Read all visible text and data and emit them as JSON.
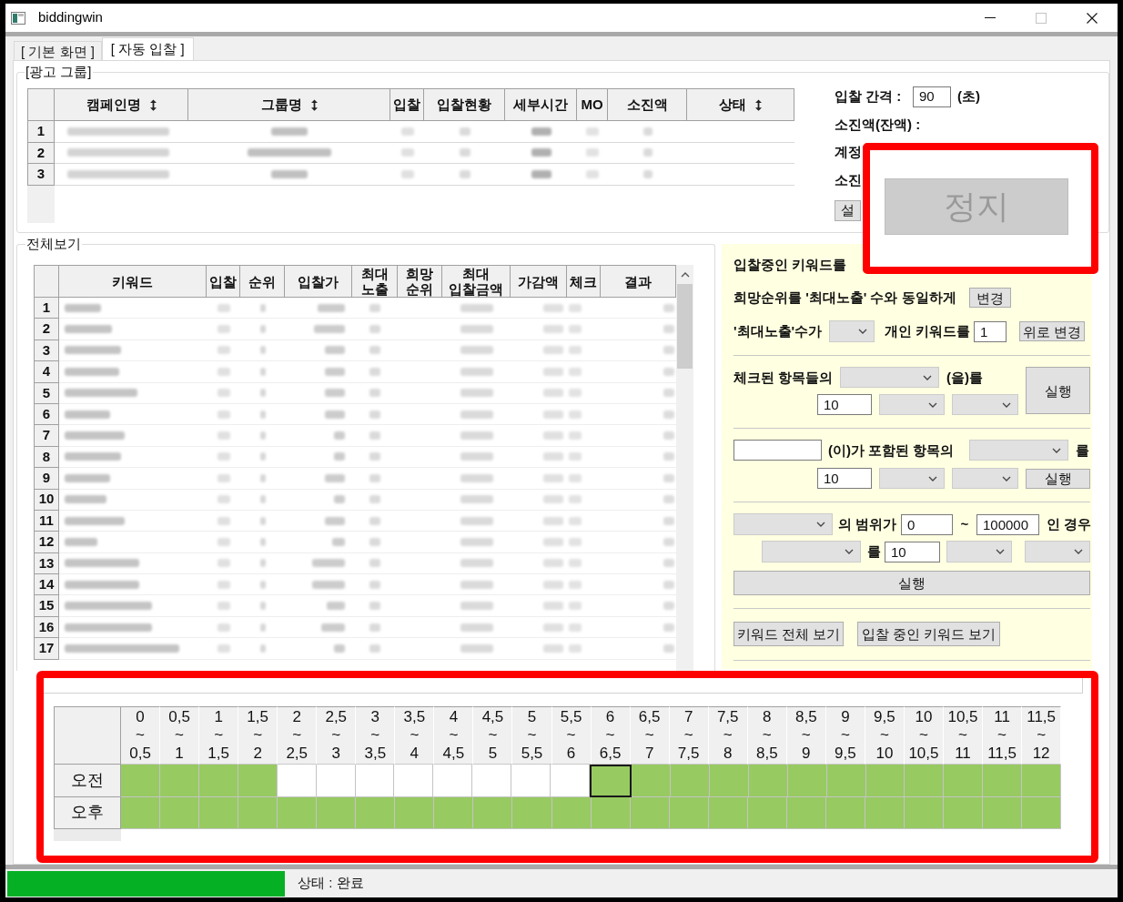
{
  "window": {
    "title": "biddingwin"
  },
  "tabs": [
    {
      "label": "[ 기본 화면 ]",
      "selected": false
    },
    {
      "label": "[ 자동 입찰 ]",
      "selected": true
    }
  ],
  "ad_group": {
    "title": "[광고 그룹]",
    "columns": [
      {
        "label": "캠페인명",
        "sortable": true
      },
      {
        "label": "그룹명",
        "sortable": true
      },
      {
        "label": "입찰",
        "sortable": false
      },
      {
        "label": "입찰현황",
        "sortable": false
      },
      {
        "label": "세부시간",
        "sortable": false
      },
      {
        "label": "MO",
        "sortable": false
      },
      {
        "label": "소진액",
        "sortable": false
      },
      {
        "label": "상태",
        "sortable": true
      }
    ],
    "rows": [
      {
        "number": "1"
      },
      {
        "number": "2"
      },
      {
        "number": "3"
      }
    ]
  },
  "bid_settings": {
    "interval_label": "입찰 간격 :",
    "interval_value": "90",
    "interval_unit": "(초)",
    "spend_label": "소진액(잔액) :",
    "account_label": "계정",
    "spend_label_2": "소진",
    "settings_button": "설"
  },
  "callout": {
    "stop_button": {
      "label": "정지",
      "disabled": true
    }
  },
  "overview": {
    "title": "전체보기",
    "columns": [
      {
        "label": "키워드"
      },
      {
        "label": "입찰"
      },
      {
        "label": "순위"
      },
      {
        "label": "입찰가"
      },
      {
        "label": "최대\n노출"
      },
      {
        "label": "희망\n순위"
      },
      {
        "label": "최대\n입찰금액"
      },
      {
        "label": "가감액"
      },
      {
        "label": "체크"
      },
      {
        "label": "결과"
      }
    ],
    "rows": [
      {
        "number": "1"
      },
      {
        "number": "2"
      },
      {
        "number": "3"
      },
      {
        "number": "4"
      },
      {
        "number": "5"
      },
      {
        "number": "6"
      },
      {
        "number": "7"
      },
      {
        "number": "8"
      },
      {
        "number": "9"
      },
      {
        "number": "10"
      },
      {
        "number": "11"
      },
      {
        "number": "12"
      },
      {
        "number": "13"
      },
      {
        "number": "14"
      },
      {
        "number": "15"
      },
      {
        "number": "16"
      },
      {
        "number": "17"
      }
    ]
  },
  "bulk_panel": {
    "heading": "입찰중인 키워드를",
    "groups": [
      {
        "items": [
          {
            "kind": "label",
            "text": "희망순위를 '최대노출' 수와 동일하게"
          },
          {
            "kind": "button",
            "text": "변경"
          }
        ]
      },
      {
        "items": [
          {
            "kind": "label",
            "text": "'최대노출'수가"
          },
          {
            "kind": "select"
          },
          {
            "kind": "label",
            "text": "개인 키워드를"
          },
          {
            "kind": "input",
            "value": "1"
          },
          {
            "kind": "button",
            "text": "위로 변경"
          }
        ]
      },
      {
        "items": [
          {
            "kind": "label",
            "text": "체크된 항목들의"
          },
          {
            "kind": "select"
          },
          {
            "kind": "label",
            "text": "(을)를"
          },
          {
            "kind": "button",
            "text": "실행"
          },
          {
            "kind": "input",
            "value": "10"
          },
          {
            "kind": "select"
          },
          {
            "kind": "select"
          }
        ]
      },
      {
        "items": [
          {
            "kind": "input"
          },
          {
            "kind": "label",
            "text": "(이)가 포함된 항목의"
          },
          {
            "kind": "select"
          },
          {
            "kind": "label",
            "text": "를"
          },
          {
            "kind": "input",
            "value": "10"
          },
          {
            "kind": "select"
          },
          {
            "kind": "select"
          },
          {
            "kind": "button",
            "text": "실행"
          }
        ]
      },
      {
        "items": [
          {
            "kind": "select"
          },
          {
            "kind": "label",
            "text": "의 범위가"
          },
          {
            "kind": "input",
            "value": "0"
          },
          {
            "kind": "label",
            "text": "~"
          },
          {
            "kind": "input",
            "value": "100000"
          },
          {
            "kind": "label",
            "text": "인 경우"
          },
          {
            "kind": "select"
          },
          {
            "kind": "label",
            "text": "를"
          },
          {
            "kind": "input",
            "value": "10"
          },
          {
            "kind": "select"
          },
          {
            "kind": "select"
          },
          {
            "kind": "button",
            "text": "실행"
          }
        ]
      },
      {
        "items": [
          {
            "kind": "button",
            "text": "키워드 전체 보기"
          },
          {
            "kind": "button",
            "text": "입찰 중인 키워드 보기"
          }
        ]
      }
    ]
  },
  "schedule": {
    "columns": [
      {
        "label": "0\n~\n0,5"
      },
      {
        "label": "0,5\n~\n1"
      },
      {
        "label": "1\n~\n1,5"
      },
      {
        "label": "1,5\n~\n2"
      },
      {
        "label": "2\n~\n2,5"
      },
      {
        "label": "2,5\n~\n3"
      },
      {
        "label": "3\n~\n3,5"
      },
      {
        "label": "3,5\n~\n4"
      },
      {
        "label": "4\n~\n4,5"
      },
      {
        "label": "4,5\n~\n5"
      },
      {
        "label": "5\n~\n5,5"
      },
      {
        "label": "5,5\n~\n6"
      },
      {
        "label": "6\n~\n6,5"
      },
      {
        "label": "6,5\n~\n7"
      },
      {
        "label": "7\n~\n7,5"
      },
      {
        "label": "7,5\n~\n8"
      },
      {
        "label": "8\n~\n8,5"
      },
      {
        "label": "8,5\n~\n9"
      },
      {
        "label": "9\n~\n9,5"
      },
      {
        "label": "9,5\n~\n10"
      },
      {
        "label": "10\n~\n10,5"
      },
      {
        "label": "10,5\n~\n11"
      },
      {
        "label": "11\n~\n11,5"
      },
      {
        "label": "11,5\n~\n12"
      }
    ],
    "rows": [
      {
        "label": "오전",
        "cells": [
          {
            "on": true,
            "selected": false
          },
          {
            "on": true,
            "selected": false
          },
          {
            "on": true,
            "selected": false
          },
          {
            "on": true,
            "selected": false
          },
          {
            "on": false,
            "selected": false
          },
          {
            "on": false,
            "selected": false
          },
          {
            "on": false,
            "selected": false
          },
          {
            "on": false,
            "selected": false
          },
          {
            "on": false,
            "selected": false
          },
          {
            "on": false,
            "selected": false
          },
          {
            "on": false,
            "selected": false
          },
          {
            "on": false,
            "selected": false
          },
          {
            "on": true,
            "selected": true
          },
          {
            "on": true,
            "selected": false
          },
          {
            "on": true,
            "selected": false
          },
          {
            "on": true,
            "selected": false
          },
          {
            "on": true,
            "selected": false
          },
          {
            "on": true,
            "selected": false
          },
          {
            "on": true,
            "selected": false
          },
          {
            "on": true,
            "selected": false
          },
          {
            "on": true,
            "selected": false
          },
          {
            "on": true,
            "selected": false
          },
          {
            "on": true,
            "selected": false
          },
          {
            "on": true,
            "selected": false
          }
        ]
      },
      {
        "label": "오후",
        "cells": [
          {
            "on": true,
            "selected": false
          },
          {
            "on": true,
            "selected": false
          },
          {
            "on": true,
            "selected": false
          },
          {
            "on": true,
            "selected": false
          },
          {
            "on": true,
            "selected": false
          },
          {
            "on": true,
            "selected": false
          },
          {
            "on": true,
            "selected": false
          },
          {
            "on": true,
            "selected": false
          },
          {
            "on": true,
            "selected": false
          },
          {
            "on": true,
            "selected": false
          },
          {
            "on": true,
            "selected": false
          },
          {
            "on": true,
            "selected": false
          },
          {
            "on": true,
            "selected": false
          },
          {
            "on": true,
            "selected": false
          },
          {
            "on": true,
            "selected": false
          },
          {
            "on": true,
            "selected": false
          },
          {
            "on": true,
            "selected": false
          },
          {
            "on": true,
            "selected": false
          },
          {
            "on": true,
            "selected": false
          },
          {
            "on": true,
            "selected": false
          },
          {
            "on": true,
            "selected": false
          },
          {
            "on": true,
            "selected": false
          },
          {
            "on": true,
            "selected": false
          },
          {
            "on": true,
            "selected": false
          }
        ]
      }
    ]
  },
  "status_bar": {
    "progress": {
      "level": 1
    },
    "text": "상태 : 완료"
  }
}
